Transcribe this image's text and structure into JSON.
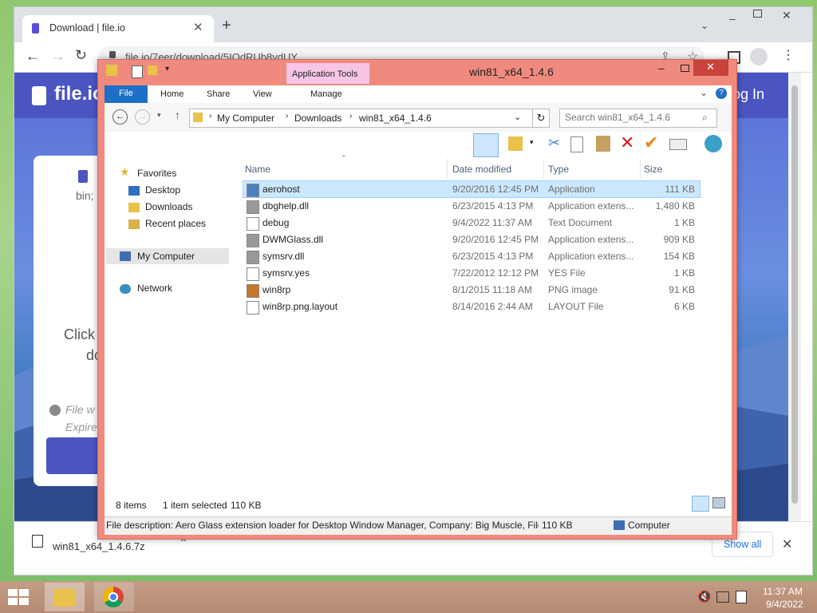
{
  "browser": {
    "tab_title": "Download | file.io",
    "url": "file.io/7eer/download/5IQdRUb8ydUY",
    "site_brand": "file.io",
    "login_label": "Log In",
    "card_line1": "bin;",
    "card_click": "Click",
    "card_click2": "do",
    "card_file_w": "File w",
    "card_expire": "Expire",
    "download_item": "win81_x64_1.4.6.7z",
    "show_all": "Show all"
  },
  "explorer": {
    "window_title": "win81_x64_1.4.6",
    "contextual_tab_group": "Application Tools",
    "ribbon_tabs": {
      "file": "File",
      "home": "Home",
      "share": "Share",
      "view": "View",
      "manage": "Manage"
    },
    "breadcrumb": [
      "My Computer",
      "Downloads",
      "win81_x64_1.4.6"
    ],
    "search_placeholder": "Search win81_x64_1.4.6",
    "columns": {
      "name": "Name",
      "date": "Date modified",
      "type": "Type",
      "size": "Size"
    },
    "nav": {
      "favorites": "Favorites",
      "desktop": "Desktop",
      "downloads": "Downloads",
      "recent": "Recent places",
      "computer": "My Computer",
      "network": "Network"
    },
    "files": [
      {
        "name": "aerohost",
        "date": "9/20/2016 12:45 PM",
        "type": "Application",
        "size": "111 KB"
      },
      {
        "name": "dbghelp.dll",
        "date": "6/23/2015 4:13 PM",
        "type": "Application extens...",
        "size": "1,480 KB"
      },
      {
        "name": "debug",
        "date": "9/4/2022 11:37 AM",
        "type": "Text Document",
        "size": "1 KB"
      },
      {
        "name": "DWMGlass.dll",
        "date": "9/20/2016 12:45 PM",
        "type": "Application extens...",
        "size": "909 KB"
      },
      {
        "name": "symsrv.dll",
        "date": "6/23/2015 4:13 PM",
        "type": "Application extens...",
        "size": "154 KB"
      },
      {
        "name": "symsrv.yes",
        "date": "7/22/2012 12:12 PM",
        "type": "YES File",
        "size": "1 KB"
      },
      {
        "name": "win8rp",
        "date": "8/1/2015 11:18 AM",
        "type": "PNG image",
        "size": "91 KB"
      },
      {
        "name": "win8rp.png.layout",
        "date": "8/14/2016 2:44 AM",
        "type": "LAYOUT File",
        "size": "6 KB"
      }
    ],
    "status": {
      "count": "8 items",
      "selected": "1 item selected",
      "selected_size": "110 KB"
    },
    "details": {
      "description": "File description: Aero Glass extension loader for Desktop Window Manager, Company: Big Muscle, File v",
      "size": "110 KB",
      "location": "Computer"
    }
  },
  "taskbar": {
    "time": "11:37 AM",
    "date": "9/4/2022"
  },
  "colors": {
    "explorer_frame": "#f08a7e",
    "file_tab": "#1e6fc7",
    "selection": "#cce8ff",
    "site_brand": "#4a55c2"
  }
}
